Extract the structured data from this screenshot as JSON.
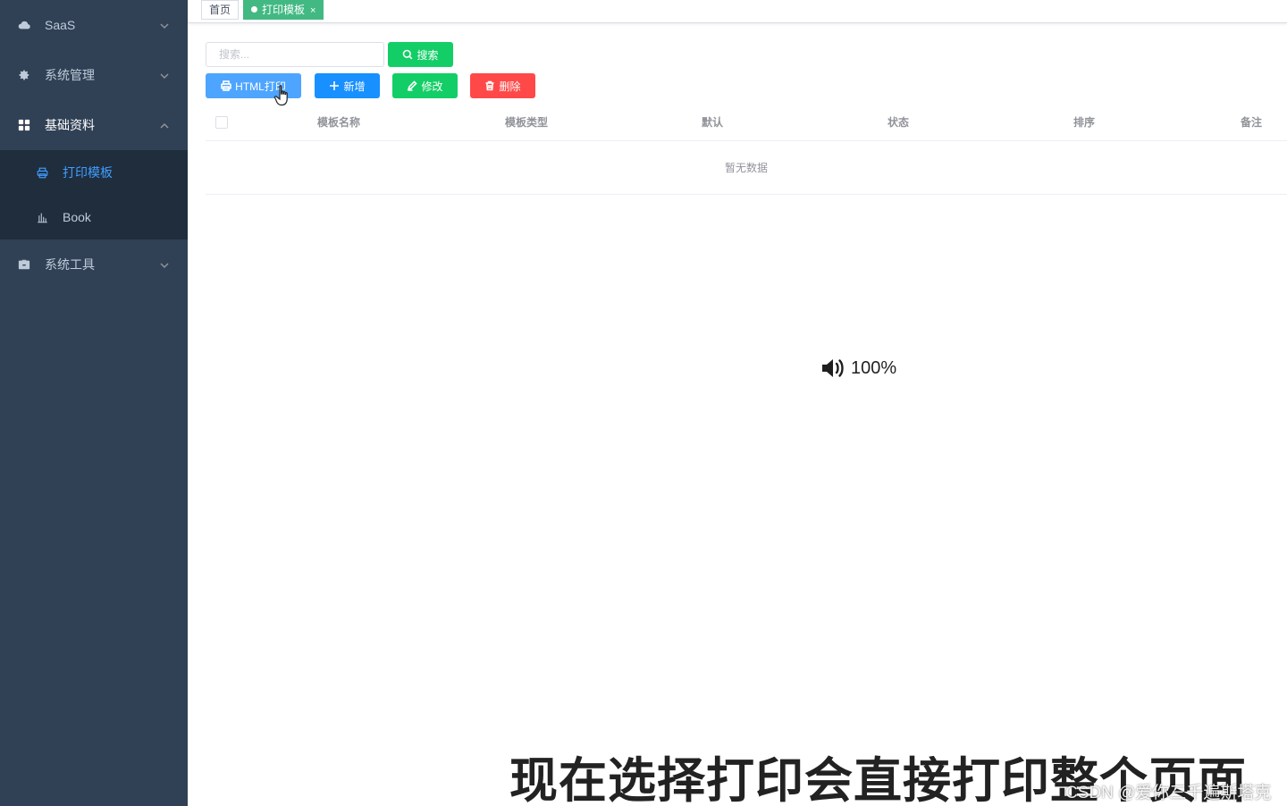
{
  "sidebar": {
    "menus": [
      {
        "label": "SaaS",
        "icon": "cloud-icon"
      },
      {
        "label": "系统管理",
        "icon": "gear-icon"
      },
      {
        "label": "基础资料",
        "icon": "grid-icon"
      },
      {
        "label": "系统工具",
        "icon": "toolbox-icon"
      }
    ],
    "subitems": [
      {
        "label": "打印模板",
        "icon": "printer-icon"
      },
      {
        "label": "Book",
        "icon": "bar-chart-icon"
      }
    ]
  },
  "tags": {
    "home": "首页",
    "current": "打印模板",
    "close": "×"
  },
  "toolbar": {
    "search_placeholder": "搜索...",
    "search_label": "搜索",
    "print_label": "HTML打印",
    "add_label": "新增",
    "edit_label": "修改",
    "delete_label": "删除"
  },
  "table": {
    "columns": [
      "模板名称",
      "模板类型",
      "默认",
      "状态",
      "排序",
      "备注"
    ],
    "empty_text": "暂无数据"
  },
  "overlay": {
    "volume_text": "100%",
    "subtitle": "现在选择打印会直接打印整个页面",
    "watermark": "CSDN @爱你三千遍斯塔克"
  },
  "colors": {
    "sidebar_bg": "#304156",
    "submenu_bg": "#1f2d3d",
    "active_text": "#409eff",
    "tag_active": "#42b983",
    "primary": "#1890ff",
    "success": "#13ce66",
    "danger": "#ff4949"
  }
}
